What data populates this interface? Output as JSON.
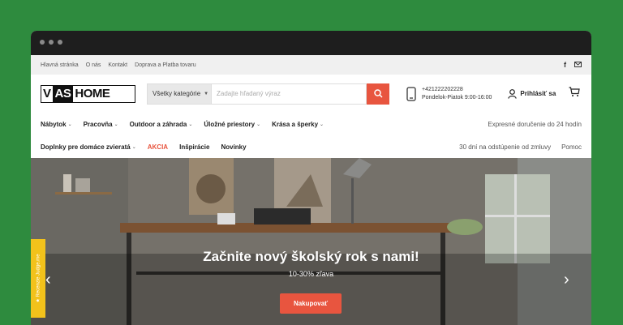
{
  "topbar": {
    "links": [
      "Hlavná stránka",
      "O nás",
      "Kontakt",
      "Doprava a Platba tovaru"
    ],
    "social": {
      "facebook_glyph": "f"
    }
  },
  "header": {
    "logo": {
      "part1": "V",
      "part2": "AS",
      "part3": "HOME"
    },
    "search": {
      "category_label": "Všetky kategórie",
      "placeholder": "Zadajte hľadaný výraz"
    },
    "contact": {
      "phone": "+421222202228",
      "hours": "Pondelok-Piatok 9:00-16:00"
    },
    "account_label": "Prihlásiť sa"
  },
  "nav": {
    "row1": [
      "Nábytok",
      "Pracovňa",
      "Outdoor a záhrada",
      "Úložné priestory",
      "Krása a šperky"
    ],
    "row1_right": "Expresné doručenie do 24 hodín",
    "row2_dropdown": "Doplnky pre domáce zvieratá",
    "row2_sale": "AKCIA",
    "row2_links": [
      "Inšpirácie",
      "Novinky"
    ],
    "row2_right": [
      "30 dní na odstúpenie od zmluvy",
      "Pomoc"
    ]
  },
  "hero": {
    "title": "Začnite nový školský rok s nami!",
    "subtitle": "10-30% zľava",
    "cta_label": "Nakupovať",
    "reviews_tab": "★ Recenzie Judge.me"
  },
  "colors": {
    "accent": "#e8553f",
    "background": "#2e8b3e",
    "reviews_tab": "#f2c21b"
  },
  "icons": [
    "facebook-icon",
    "mail-icon",
    "chevron-down-icon",
    "search-icon",
    "phone-icon",
    "user-icon",
    "cart-icon",
    "chevron-left-icon",
    "chevron-right-icon"
  ]
}
